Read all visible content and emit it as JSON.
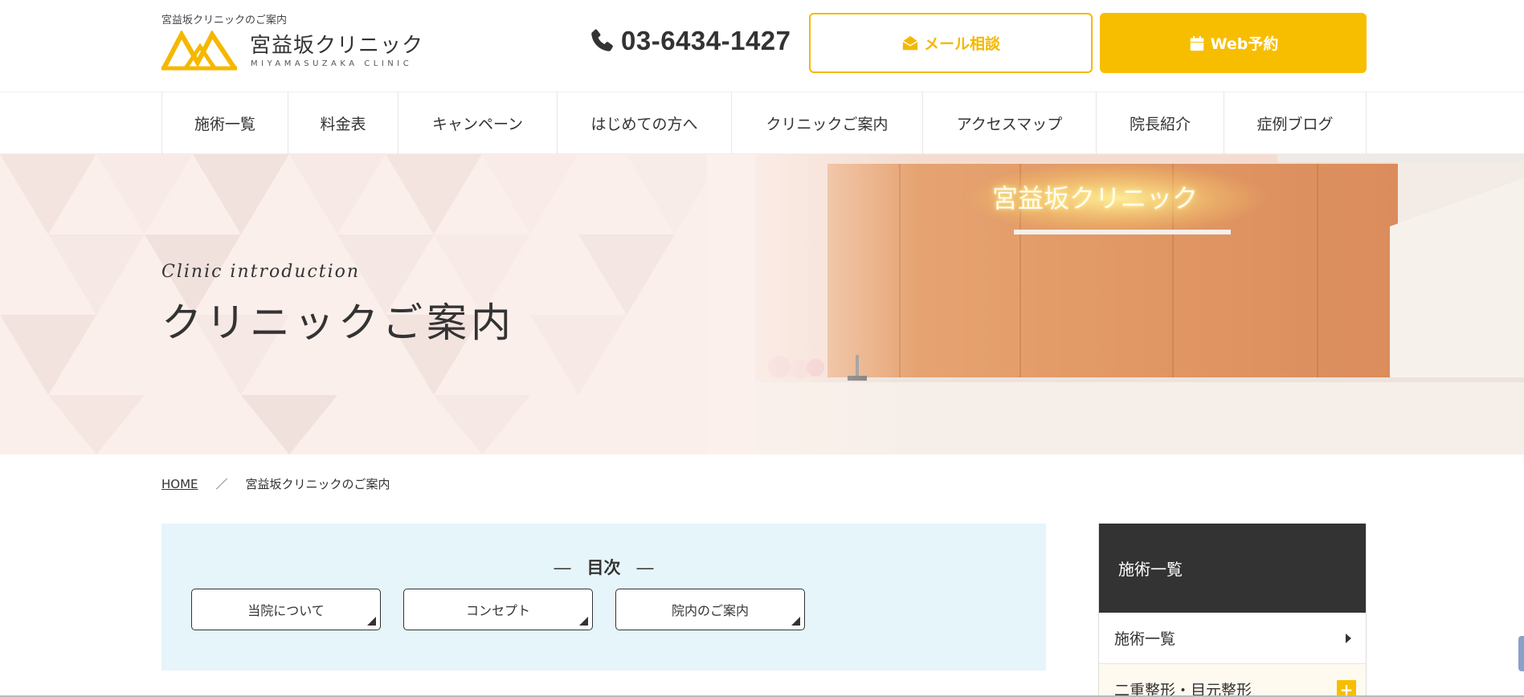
{
  "header": {
    "tagline": "宮益坂クリニックのご案内",
    "clinic_name": "宮益坂クリニック",
    "clinic_name_roman": "MIYAMASUZAKA CLINIC",
    "phone": "03-6434-1427",
    "mail_button": "メール相談",
    "web_button": "Web予約",
    "accent_color": "#f7be00"
  },
  "nav": {
    "items": [
      "施術一覧",
      "料金表",
      "キャンペーン",
      "はじめての方へ",
      "クリニックご案内",
      "アクセスマップ",
      "院長紹介",
      "症例ブログ"
    ]
  },
  "hero": {
    "subtitle_en": "Clinic introduction",
    "title": "クリニックご案内",
    "sign_text": "宮益坂クリニック"
  },
  "breadcrumb": {
    "home": "HOME",
    "separator": "／",
    "current": "宮益坂クリニックのご案内"
  },
  "toc": {
    "title": "目次",
    "dash": "―",
    "items": [
      "当院について",
      "コンセプト",
      "院内のご案内"
    ]
  },
  "sidebar": {
    "heading": "施術一覧",
    "items": [
      "施術一覧",
      "二重整形・目元整形"
    ]
  }
}
